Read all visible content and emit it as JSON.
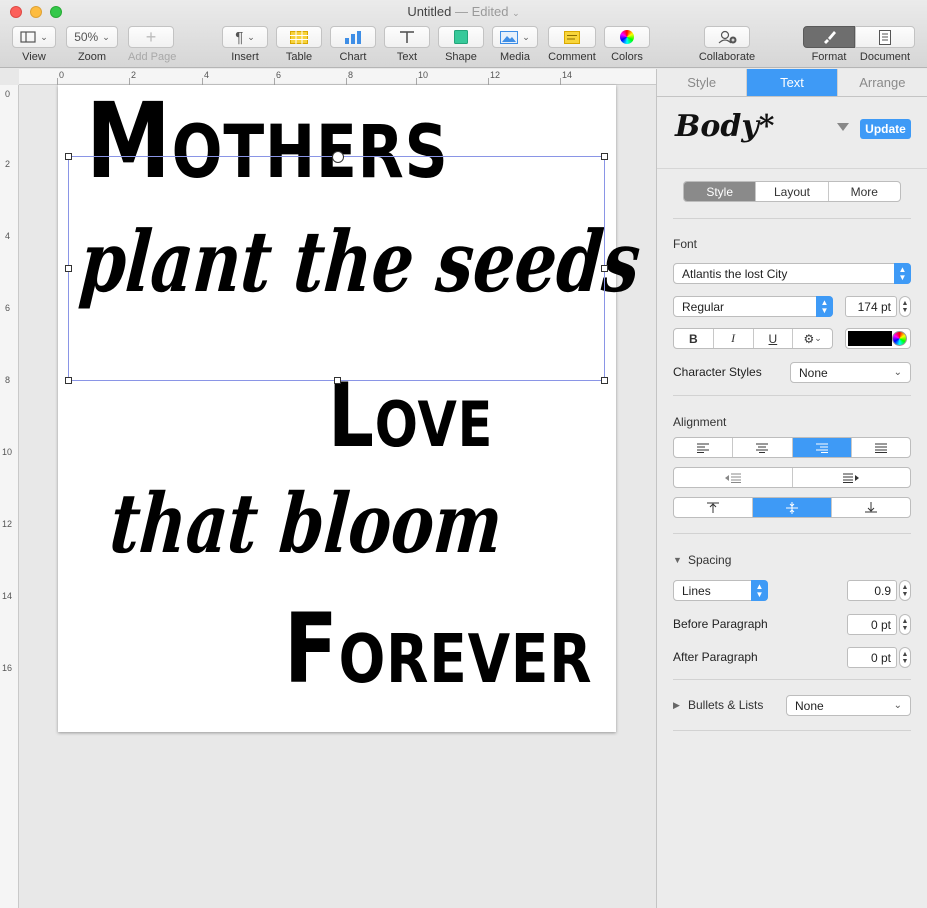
{
  "window": {
    "title": "Untitled",
    "status": "— Edited"
  },
  "toolbar": {
    "view": "View",
    "zoom_value": "50%",
    "zoom": "Zoom",
    "add_page": "Add Page",
    "insert": "Insert",
    "table": "Table",
    "chart": "Chart",
    "text": "Text",
    "shape": "Shape",
    "media": "Media",
    "comment": "Comment",
    "colors": "Colors",
    "collaborate": "Collaborate",
    "format": "Format",
    "document": "Document"
  },
  "ruler": {
    "top": [
      "0",
      "2",
      "4",
      "6",
      "8",
      "10",
      "12",
      "14"
    ],
    "left": [
      "0",
      "2",
      "4",
      "6",
      "8",
      "10",
      "12",
      "14",
      "16"
    ]
  },
  "document": {
    "line1": "Mothers",
    "line2": "plant the seeds of",
    "line3": "Love",
    "line4": "that bloom",
    "line5": "Forever"
  },
  "inspector": {
    "tabs": [
      "Style",
      "Text",
      "Arrange"
    ],
    "active_tab": "Text",
    "paragraph_style": "Body*",
    "update": "Update",
    "subtabs": [
      "Style",
      "Layout",
      "More"
    ],
    "font_label": "Font",
    "font_family": "Atlantis the lost City",
    "font_style": "Regular",
    "font_size": "174 pt",
    "bold": "B",
    "italic": "I",
    "underline": "U",
    "text_color": "#000000",
    "character_styles_label": "Character Styles",
    "character_styles_value": "None",
    "alignment_label": "Alignment",
    "spacing_label": "Spacing",
    "spacing_mode": "Lines",
    "spacing_value": "0.9",
    "before_paragraph_label": "Before Paragraph",
    "before_paragraph_value": "0 pt",
    "after_paragraph_label": "After Paragraph",
    "after_paragraph_value": "0 pt",
    "bullets_label": "Bullets & Lists",
    "bullets_value": "None",
    "accent_color": "#3e9af6"
  }
}
